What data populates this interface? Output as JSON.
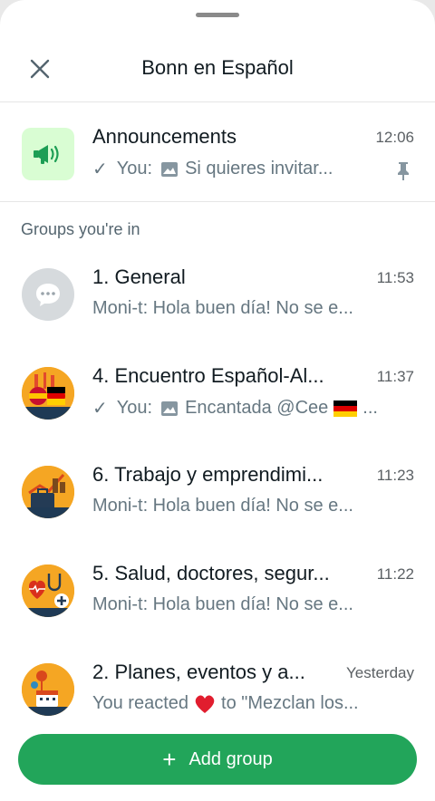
{
  "header": {
    "title": "Bonn en Español",
    "close_icon": "close-icon"
  },
  "announcements": {
    "name": "Announcements",
    "time": "12:06",
    "prefix": "You:",
    "message": "Si quieres invitar...",
    "icons": [
      "double-check-icon",
      "image-icon",
      "pin-icon"
    ]
  },
  "section_label": "Groups you're in",
  "groups": [
    {
      "name": "1. General",
      "time": "11:53",
      "message": "Moni-t: Hola buen día!  No se e..."
    },
    {
      "name": "4. Encuentro Español-Al...",
      "time": "11:37",
      "prefix": "You:",
      "message": "Encantada @Cee",
      "suffix": "..."
    },
    {
      "name": "6. Trabajo y emprendimi...",
      "time": "11:23",
      "message": "Moni-t: Hola buen día!  No se e..."
    },
    {
      "name": "5. Salud, doctores, segur...",
      "time": "11:22",
      "message": "Moni-t: Hola buen día!  No se e..."
    },
    {
      "name": "2. Planes, eventos y a...",
      "time": "Yesterday",
      "msg_before": "You reacted",
      "msg_after": "to \"Mezclan los..."
    }
  ],
  "add_button": {
    "label": "Add group",
    "icon": "plus-icon"
  },
  "colors": {
    "accent": "#22a55a",
    "announcement_bg": "#d9fdd3"
  }
}
